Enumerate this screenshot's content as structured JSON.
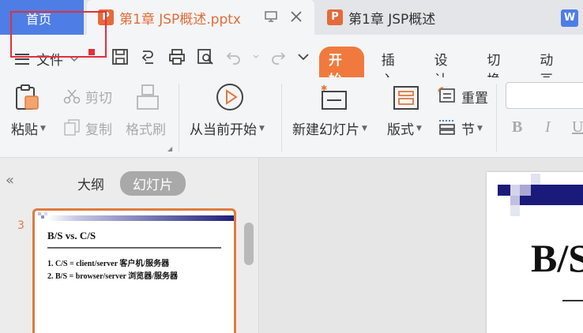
{
  "tabs": {
    "home_label": "首页",
    "active_doc": "第1章 JSP概述.pptx",
    "other_doc": "第1章 JSP概述",
    "ppt_badge": "P",
    "wps_badge": "W"
  },
  "menubar": {
    "file_label": "文件",
    "items": [
      "开始",
      "插入",
      "设计",
      "切换",
      "动画"
    ],
    "active_index": 0
  },
  "ribbon": {
    "paste": "粘贴",
    "cut": "剪切",
    "copy": "复制",
    "format_painter": "格式刷",
    "from_current": "从当前开始",
    "new_slide": "新建幻灯片",
    "layout": "版式",
    "reset": "重置",
    "section": "节",
    "bold": "B",
    "italic": "I",
    "underline": "U"
  },
  "panel": {
    "outline_label": "大纲",
    "slides_label": "幻灯片",
    "slide_number": "3",
    "thumb_title": "B/S vs. C/S",
    "thumb_line1": "1. C/S = client/server 客户机/服务器",
    "thumb_line2": "2. B/S = browser/server 浏览器/服务器"
  },
  "main_slide": {
    "title": "B/S"
  },
  "colors": {
    "accent": "#f07a3e",
    "home_blue": "#4e7de6",
    "annotation_red": "#e0303c"
  }
}
